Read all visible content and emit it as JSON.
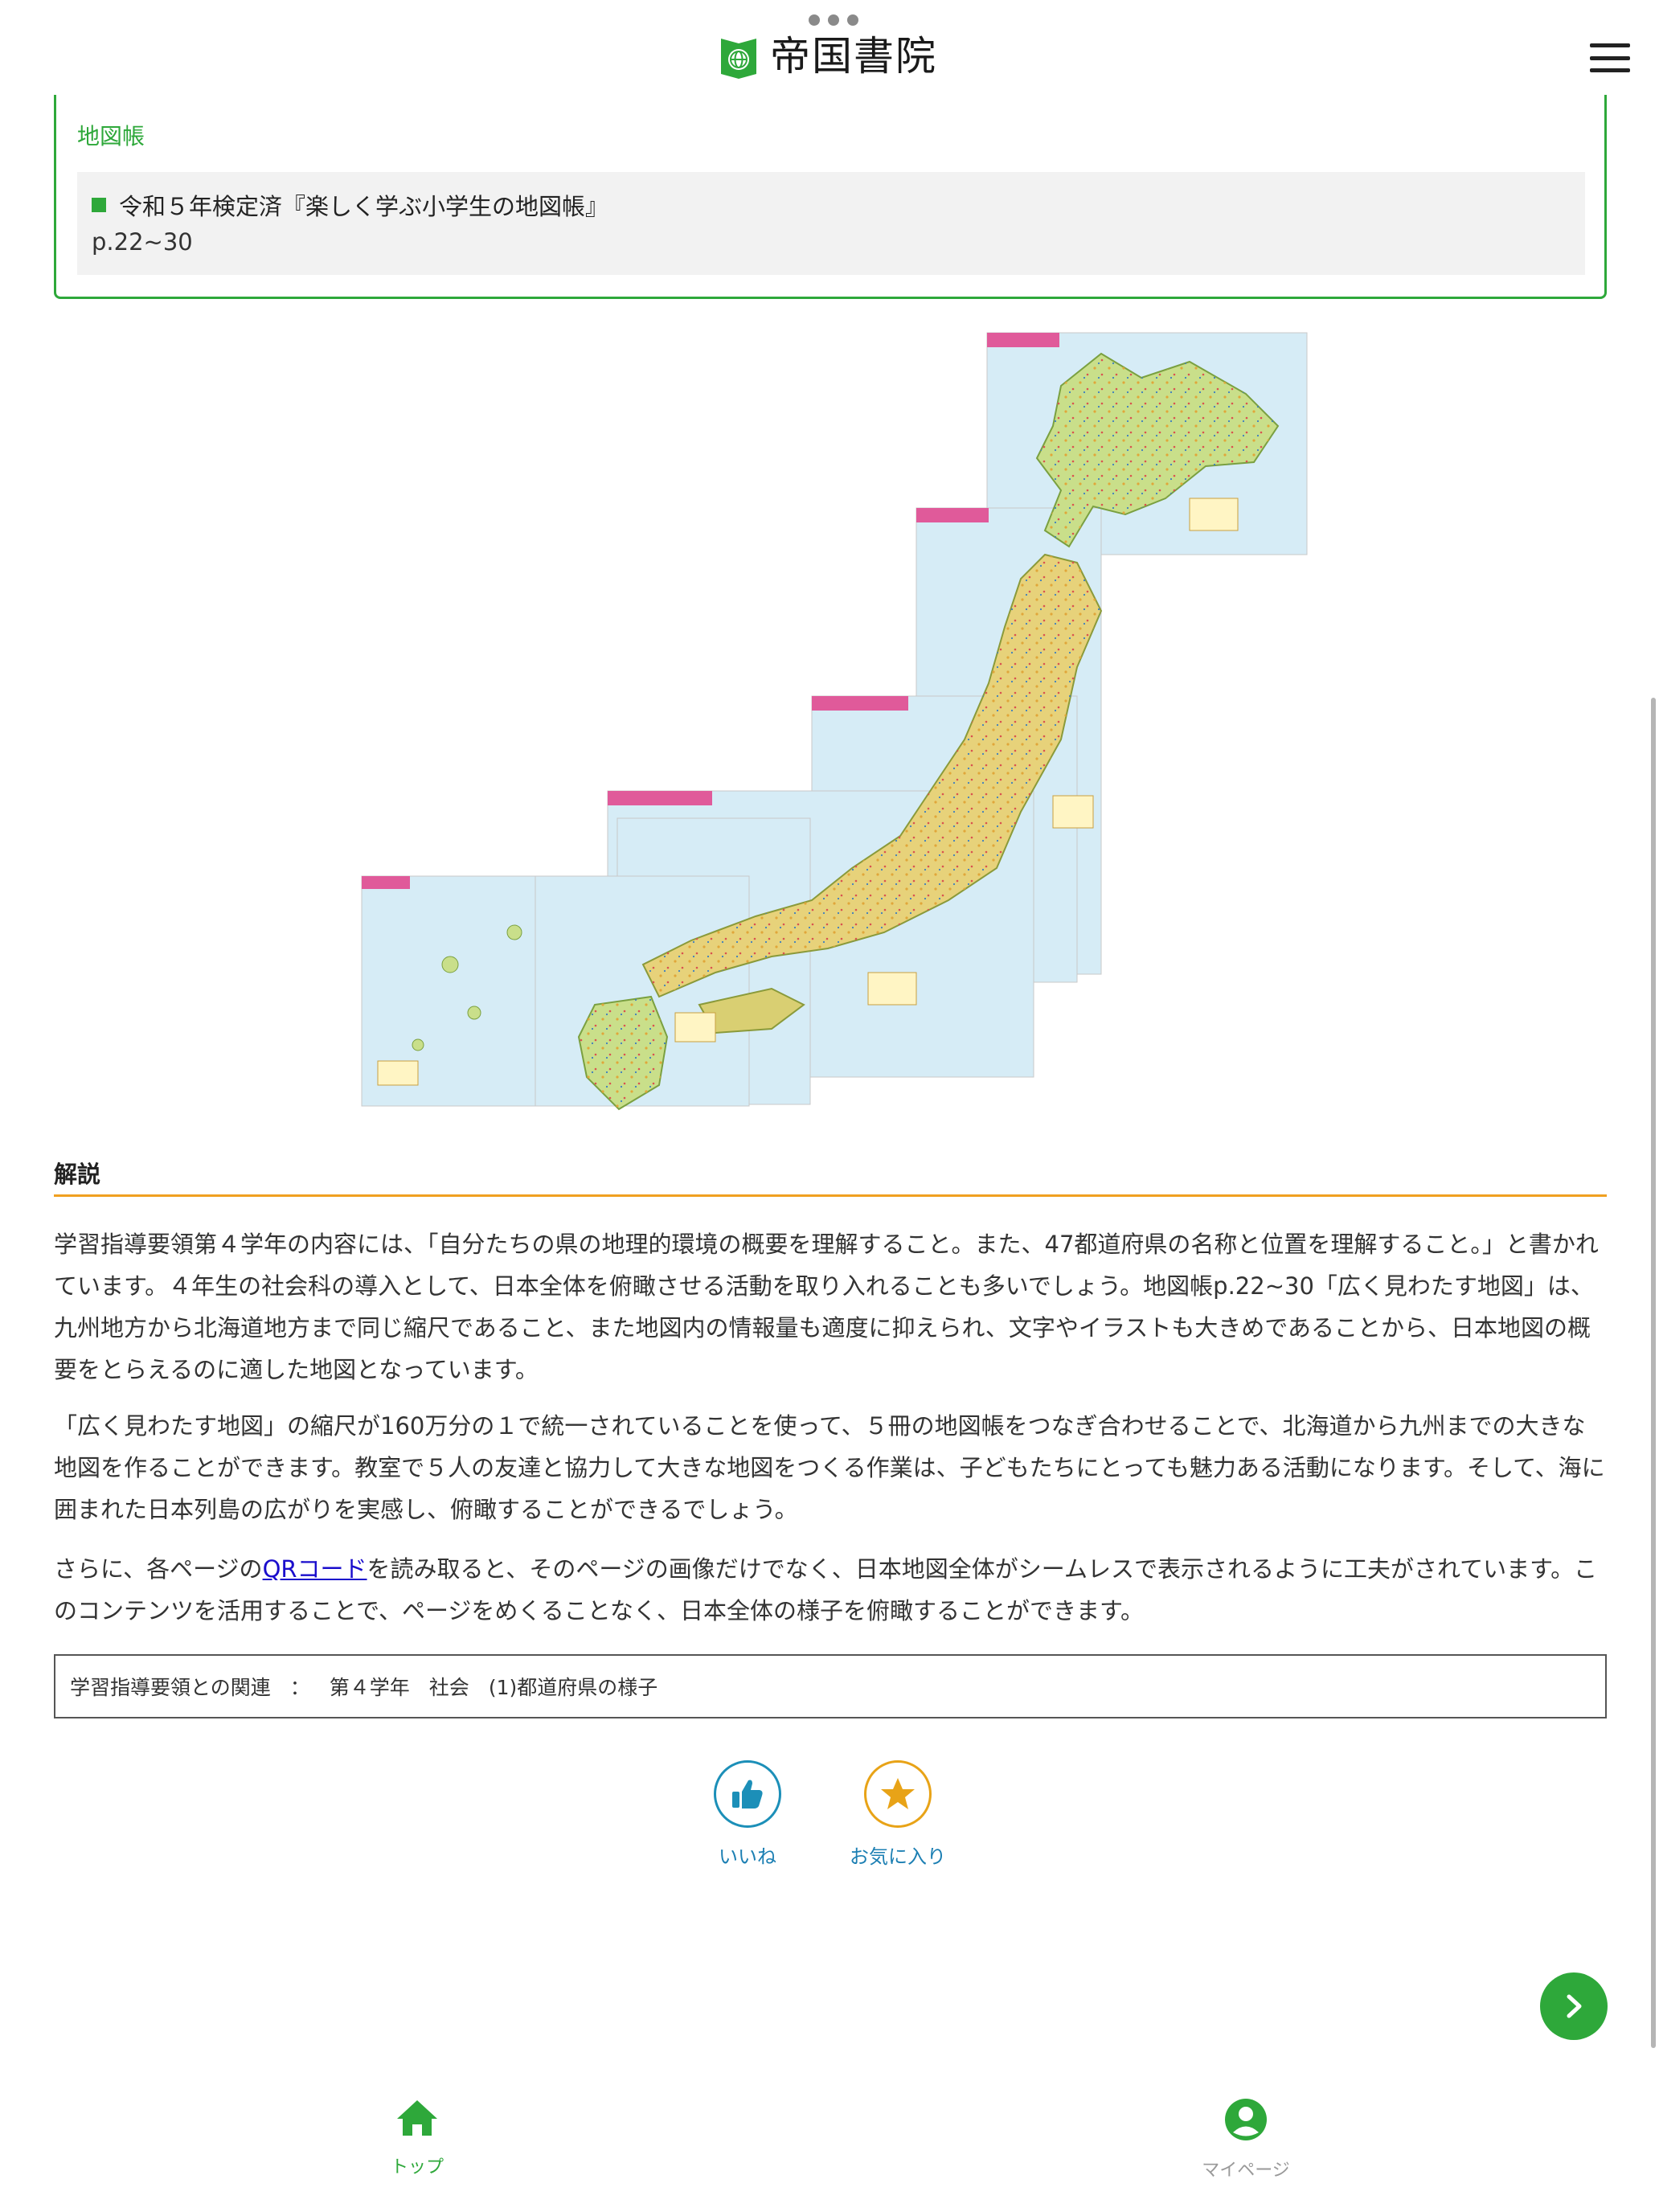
{
  "header": {
    "logo_text": "帝国書院",
    "logo_icon": "globe-book-icon",
    "menu_icon": "hamburger-icon"
  },
  "material": {
    "title": "地図帳",
    "name": "令和５年検定済『楽しく学ぶ小学生の地図帳』",
    "pages": "p.22~30"
  },
  "explanation": {
    "heading": "解説",
    "p1": "学習指導要領第４学年の内容には、「自分たちの県の地理的環境の概要を理解すること。また、47都道府県の名称と位置を理解すること。」と書かれています。４年生の社会科の導入として、日本全体を俯瞰させる活動を取り入れることも多いでしょう。地図帳p.22~30「広く見わたす地図」は、九州地方から北海道地方まで同じ縮尺であること、また地図内の情報量も適度に抑えられ、文字やイラストも大きめであることから、日本地図の概要をとらえるのに適した地図となっています。",
    "p2": "「広く見わたす地図」の縮尺が160万分の１で統一されていることを使って、５冊の地図帳をつなぎ合わせることで、北海道から九州までの大きな地図を作ることができます。教室で５人の友達と協力して大きな地図をつくる作業は、子どもたちにとっても魅力ある活動になります。そして、海に囲まれた日本列島の広がりを実感し、俯瞰することができるでしょう。",
    "p3_before": "さらに、各ページの",
    "p3_link": "QRコード",
    "p3_after": "を読み取ると、そのページの画像だけでなく、日本地図全体がシームレスで表示されるように工夫がされています。このコンテンツを活用することで、ページをめくることなく、日本全体の様子を俯瞰することができます。"
  },
  "relation": {
    "label": "学習指導要領との関連",
    "separator": "：",
    "grade": "第４学年",
    "subject": "社会",
    "topic": "(1)都道府県の様子"
  },
  "reactions": {
    "like_label": "いいね",
    "like_icon": "thumbs-up-icon",
    "fav_label": "お気に入り",
    "fav_icon": "star-icon"
  },
  "bottom_nav": {
    "top_label": "トップ",
    "top_icon": "home-icon",
    "mypage_label": "マイページ",
    "mypage_icon": "user-circle-icon"
  },
  "colors": {
    "brand_green": "#2ea83a",
    "accent_orange": "#f0a020",
    "link_blue": "#1a0dcc",
    "like_blue": "#1c8fb8",
    "fav_gold": "#e8a317"
  }
}
